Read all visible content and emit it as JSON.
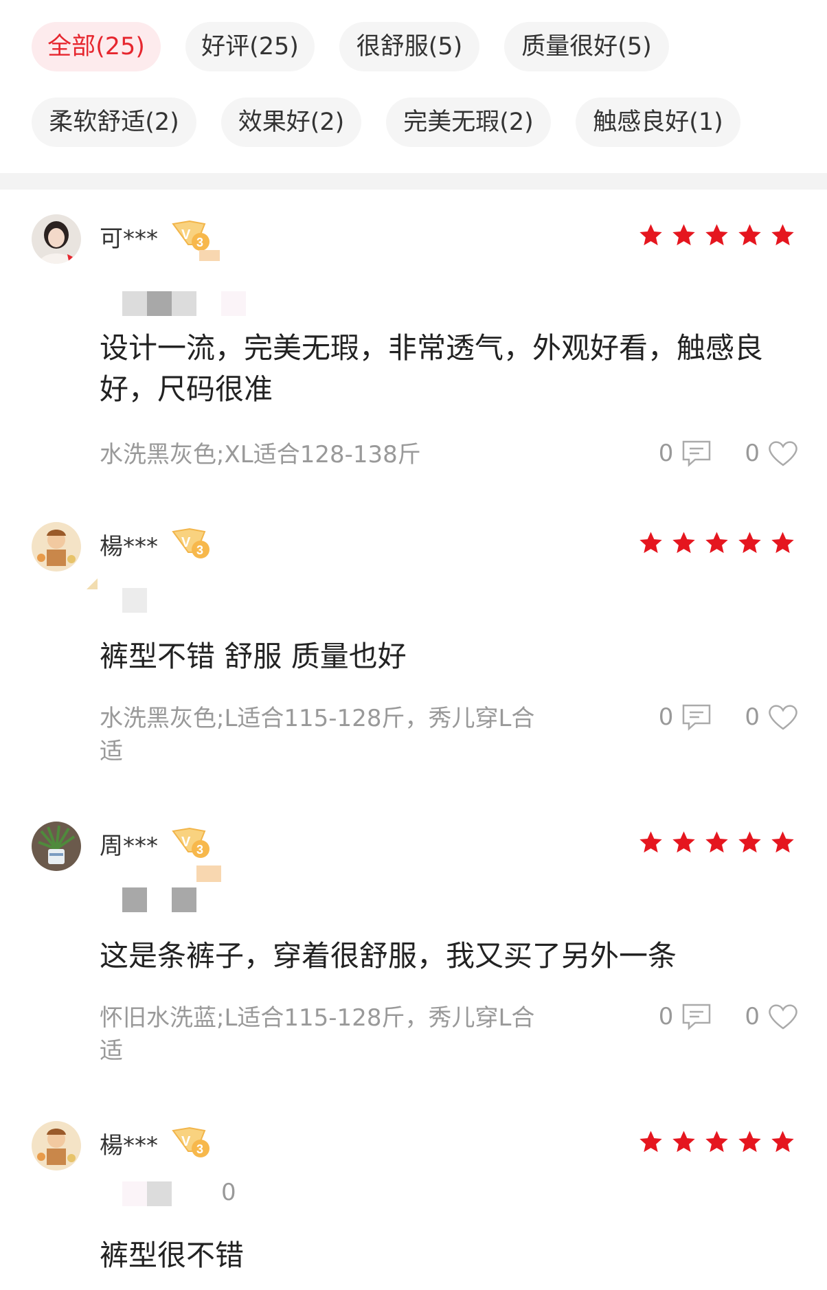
{
  "tags": [
    {
      "label": "全部(25)",
      "active": true
    },
    {
      "label": "好评(25)",
      "active": false
    },
    {
      "label": "很舒服(5)",
      "active": false
    },
    {
      "label": "质量很好(5)",
      "active": false
    },
    {
      "label": "柔软舒适(2)",
      "active": false
    },
    {
      "label": "效果好(2)",
      "active": false
    },
    {
      "label": "完美无瑕(2)",
      "active": false
    },
    {
      "label": "触感良好(1)",
      "active": false
    }
  ],
  "reviews": [
    {
      "username": "可***",
      "vip_level": "3",
      "stars": 5,
      "content": "设计一流，完美无瑕，非常透气，外观好看，触感良好，尺码很准",
      "spec": "水洗黑灰色;XL适合128-138斤",
      "comment_count": "0",
      "like_count": "0"
    },
    {
      "username": "楊***",
      "vip_level": "3",
      "stars": 5,
      "content": "裤型不错 舒服 质量也好",
      "spec": "水洗黑灰色;L适合115-128斤，秀儿穿L合适",
      "comment_count": "0",
      "like_count": "0"
    },
    {
      "username": "周***",
      "vip_level": "3",
      "stars": 5,
      "content": "这是条裤子，穿着很舒服，我又买了另外一条",
      "spec": "怀旧水洗蓝;L适合115-128斤，秀儿穿L合适",
      "comment_count": "0",
      "like_count": "0"
    },
    {
      "username": "楊***",
      "vip_level": "3",
      "stars": 5,
      "content": "裤型很不错",
      "partial_text": "0"
    }
  ],
  "colors": {
    "accent": "#e6262e",
    "star": "#e5161f",
    "tag_bg": "#f5f5f5",
    "tag_active_bg": "#fdebed",
    "vip_gold": "#f7c66a"
  },
  "icons": {
    "comment": "comment-icon",
    "like": "heart-icon",
    "star": "star-icon",
    "vip": "vip-badge-icon"
  }
}
